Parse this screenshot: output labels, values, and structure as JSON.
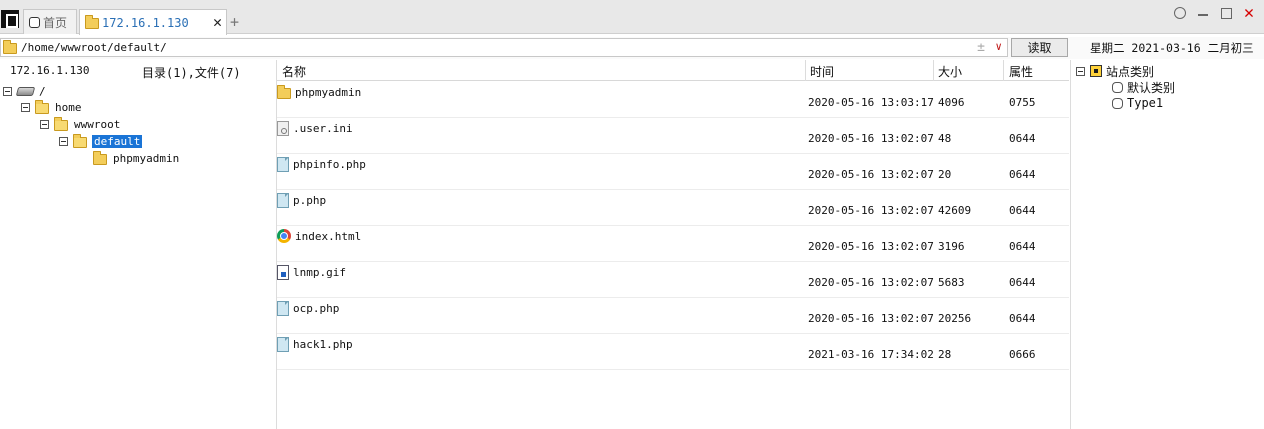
{
  "tabs": [
    {
      "label": "首页"
    },
    {
      "label": "172.16.1.130"
    }
  ],
  "tab_close": "✕",
  "tab_add": "+",
  "address": {
    "path": "/home/wwwroot/default/",
    "read_label": "读取",
    "plus_glyph": "±",
    "drop_glyph": "∨"
  },
  "date": "星期二  2021-03-16  二月初三",
  "left": {
    "ip": "172.16.1.130",
    "count": "目录(1),文件(7)",
    "tree": [
      {
        "label": "/"
      },
      {
        "label": "home"
      },
      {
        "label": "wwwroot"
      },
      {
        "label": "default"
      },
      {
        "label": "phpmyadmin"
      }
    ]
  },
  "columns": {
    "name": "名称",
    "time": "时间",
    "size": "大小",
    "attr": "属性"
  },
  "files": [
    {
      "name": "phpmyadmin",
      "time": "2020-05-16 13:03:17",
      "size": "4096",
      "attr": "0755",
      "icon": "folder-icon"
    },
    {
      "name": ".user.ini",
      "time": "2020-05-16 13:02:07",
      "size": "48",
      "attr": "0644",
      "icon": "settings-file-icon"
    },
    {
      "name": "phpinfo.php",
      "time": "2020-05-16 13:02:07",
      "size": "20",
      "attr": "0644",
      "icon": "document-icon"
    },
    {
      "name": "p.php",
      "time": "2020-05-16 13:02:07",
      "size": "42609",
      "attr": "0644",
      "icon": "document-icon"
    },
    {
      "name": "index.html",
      "time": "2020-05-16 13:02:07",
      "size": "3196",
      "attr": "0644",
      "icon": "chrome-icon"
    },
    {
      "name": "lnmp.gif",
      "time": "2020-05-16 13:02:07",
      "size": "5683",
      "attr": "0644",
      "icon": "image-file-icon"
    },
    {
      "name": "ocp.php",
      "time": "2020-05-16 13:02:07",
      "size": "20256",
      "attr": "0644",
      "icon": "document-icon"
    },
    {
      "name": "hack1.php",
      "time": "2021-03-16 17:34:02",
      "size": "28",
      "attr": "0666",
      "icon": "document-icon"
    }
  ],
  "right": {
    "root": "站点类别",
    "items": [
      {
        "label": "默认类别"
      },
      {
        "label": "Type1"
      }
    ]
  },
  "colors": {
    "accent": "#1a74d6",
    "tab_active_text": "#2a6fb5",
    "close_red": "#d60000"
  }
}
